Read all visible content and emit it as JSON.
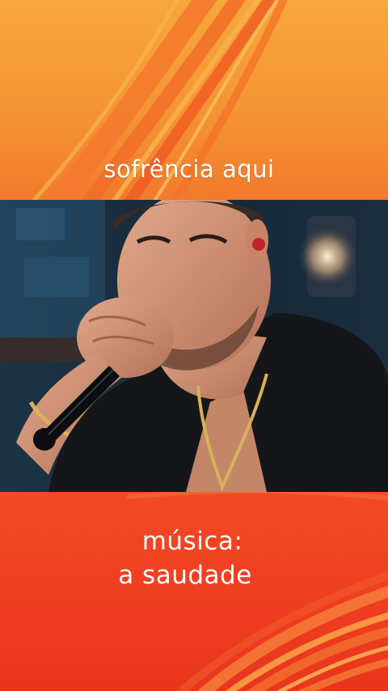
{
  "top_caption": "sofrência aqui",
  "bottom_caption": {
    "line1": "música:",
    "line2": "a saudade"
  },
  "colors": {
    "top_background": "#f59434",
    "bottom_background": "#ee3d20",
    "caption_text": "#ffffff"
  },
  "video": {
    "description_icon": "singer-with-microphone-image"
  }
}
